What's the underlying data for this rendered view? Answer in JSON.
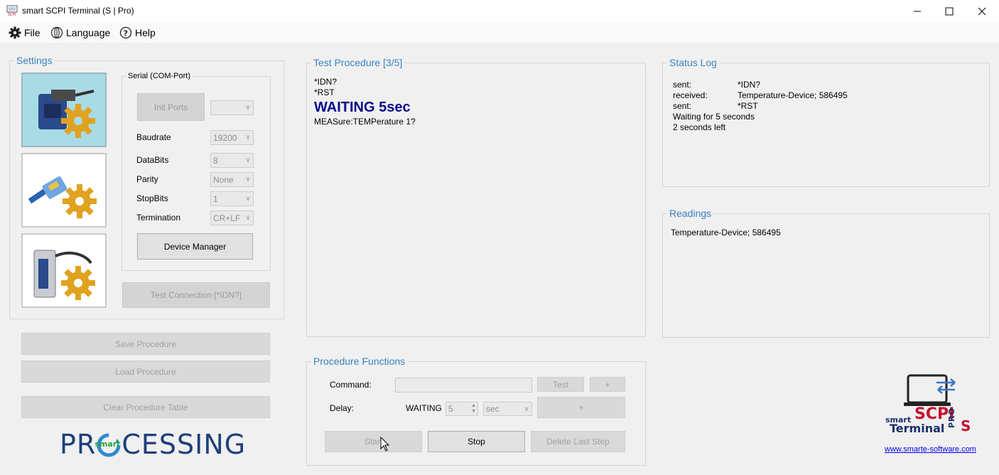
{
  "window": {
    "title": "smart SCPI Terminal (S | Pro)",
    "minimize": "—",
    "maximize": "☐",
    "close": "✕"
  },
  "menu": {
    "file": "File",
    "language": "Language",
    "help": "Help"
  },
  "settings": {
    "title": "Settings",
    "serial_group": "Serial (COM-Port)",
    "init_ports": "Init Ports",
    "port_value": "",
    "baudrate_label": "Baudrate",
    "baudrate_value": "19200",
    "databits_label": "DataBits",
    "databits_value": "8",
    "parity_label": "Parity",
    "parity_value": "None",
    "stopbits_label": "StopBits",
    "stopbits_value": "1",
    "termination_label": "Termination",
    "termination_value": "CR+LF",
    "device_manager": "Device Manager",
    "test_connection": "Test Connection [*IDN?]"
  },
  "procedure_buttons": {
    "save": "Save Procedure",
    "load": "Load Procedure",
    "clear": "Clear Procedure Table"
  },
  "processing_logo": {
    "text_left": "PR",
    "text_right": "CESSING",
    "badge": "smart",
    "color": "#1f3f7a",
    "accent": "#2aa53a"
  },
  "test_procedure": {
    "title": "Test Procedure [3/5]",
    "lines": [
      "*IDN?",
      "*RST"
    ],
    "waiting": "WAITING 5sec",
    "waiting_color": "#0a0a8c",
    "next_line": "MEASure:TEMPerature 1?"
  },
  "status_log": {
    "title": "Status Log",
    "entries": [
      {
        "key": "sent:",
        "value": "*IDN?"
      },
      {
        "key": "received:",
        "value": "Temperature-Device; 586495"
      },
      {
        "key": "sent:",
        "value": "*RST"
      }
    ],
    "line_waiting": "Waiting for 5 seconds",
    "line_left": "2 seconds left"
  },
  "readings": {
    "title": "Readings",
    "value": "Temperature-Device; 586495"
  },
  "procedure_functions": {
    "title": "Procedure Functions",
    "command_label": "Command:",
    "command_value": "",
    "test_button": "Test",
    "plus_button": "+",
    "delay_label": "Delay:",
    "waiting_label": "WAITING",
    "delay_value": "5",
    "unit_value": "sec",
    "plus_button_2": "+",
    "start_button": "Start",
    "stop_button": "Stop",
    "delete_button": "Delete Last Step"
  },
  "brand": {
    "smart": "smart",
    "scpi": "SCPI",
    "terminal": "Terminal",
    "pro": "PRO",
    "s": "S",
    "link": "www.smarte-software.com",
    "navy": "#1a2f6b",
    "red": "#c4122f"
  }
}
